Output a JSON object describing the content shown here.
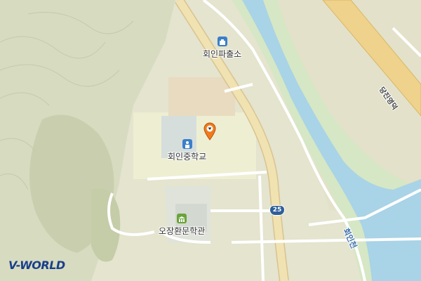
{
  "map": {
    "pois": [
      {
        "label": "회인파출소",
        "icon": "police-icon"
      },
      {
        "label": "회인중학교",
        "icon": "school-icon"
      },
      {
        "label": "오장환문학관",
        "icon": "museum-icon"
      }
    ],
    "road_label": "당진영덕",
    "river_label": "회인천",
    "route_number": "25",
    "logo_text": "V-WORLD",
    "colors": {
      "land": "#e4e4cf",
      "forest": "#c8d0b2",
      "water": "#a9d3e6",
      "river_bank": "#d5e7c4",
      "highway": "#efd28c",
      "road": "#ffffff",
      "major_road": "#f1e2b2"
    }
  }
}
